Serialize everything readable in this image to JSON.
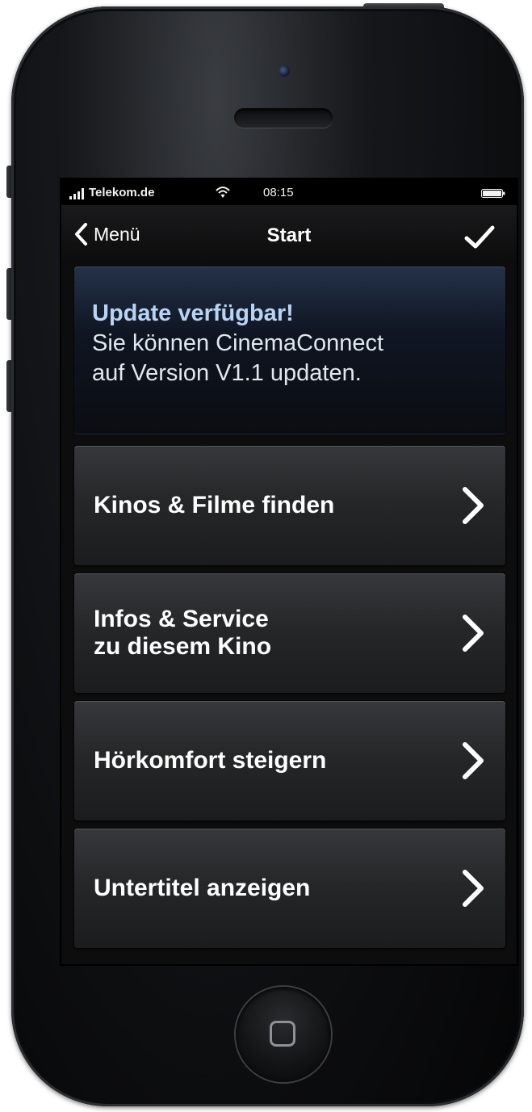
{
  "statusbar": {
    "carrier": "Telekom.de",
    "time": "08:15",
    "icons": [
      "signal-icon",
      "wifi-icon",
      "battery-icon"
    ]
  },
  "navbar": {
    "back_label": "Menü",
    "title": "Start",
    "confirm_icon": "checkmark-icon"
  },
  "update": {
    "title": "Update verfügbar!",
    "line1": "Sie können CinemaConnect",
    "line2": "auf Version V1.1 updaten."
  },
  "menu": {
    "items": [
      {
        "label": "Kinos & Filme finden",
        "icon": "chevron-right-icon"
      },
      {
        "label": "Infos & Service\nzu diesem Kino",
        "icon": "chevron-right-icon"
      },
      {
        "label": "Hörkomfort steigern",
        "icon": "chevron-right-icon"
      },
      {
        "label": "Untertitel anzeigen",
        "icon": "chevron-right-icon"
      }
    ]
  },
  "colors": {
    "update_title": "#b9d3f4",
    "update_panel": "#0f1522",
    "menu_bg": "#262729",
    "text": "#ffffff"
  }
}
